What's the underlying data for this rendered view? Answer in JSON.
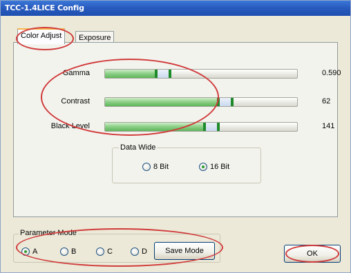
{
  "window": {
    "title": "TCC-1.4LICE Config"
  },
  "tabs": [
    {
      "label": "Color Adjust",
      "active": true
    },
    {
      "label": "Exposure",
      "active": false
    }
  ],
  "sliders": [
    {
      "label": "Gamma",
      "value_text": "0.590",
      "level": 0.3
    },
    {
      "label": "Contrast",
      "value_text": "62",
      "level": 0.62
    },
    {
      "label": "Black Level",
      "value_text": "141",
      "level": 0.55
    }
  ],
  "data_wide": {
    "legend": "Data Wide",
    "options": [
      {
        "label": "8 Bit",
        "checked": false
      },
      {
        "label": "16 Bit",
        "checked": true
      }
    ]
  },
  "parameter_mode": {
    "legend": "Parameter Mode",
    "options": [
      {
        "label": "A",
        "checked": true
      },
      {
        "label": "B",
        "checked": false
      },
      {
        "label": "C",
        "checked": false
      },
      {
        "label": "D",
        "checked": false
      }
    ],
    "save_label": "Save Mode"
  },
  "ok_label": "OK",
  "colors": {
    "title_bar": "#2a5cc0",
    "annotation": "#d03a3a",
    "slider_fill": "#5eb55a"
  }
}
